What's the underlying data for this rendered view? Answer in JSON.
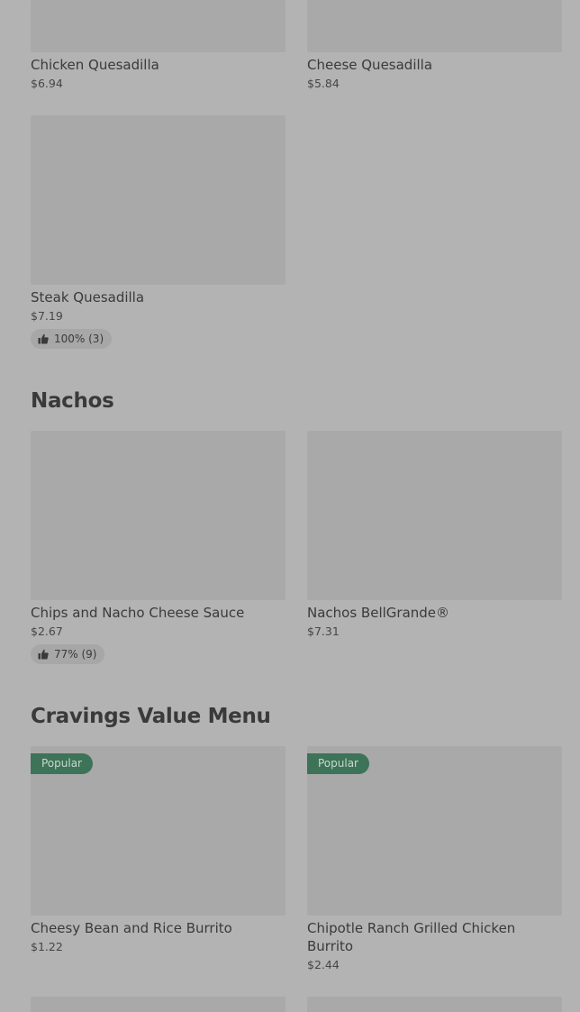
{
  "quesadillas": {
    "items": [
      {
        "name": "Chicken Quesadilla",
        "price": "$6.94"
      },
      {
        "name": "Cheese Quesadilla",
        "price": "$5.84"
      },
      {
        "name": "Steak Quesadilla",
        "price": "$7.19",
        "rating": "100% (3)"
      }
    ]
  },
  "nachos": {
    "title": "Nachos",
    "items": [
      {
        "name": "Chips and Nacho Cheese Sauce",
        "price": "$2.67",
        "rating": "77% (9)"
      },
      {
        "name": "Nachos BellGrande®",
        "price": "$7.31"
      }
    ]
  },
  "cravings": {
    "title": "Cravings Value Menu",
    "items": [
      {
        "name": "Cheesy Bean and Rice Burrito",
        "price": "$1.22",
        "badge": "Popular"
      },
      {
        "name": "Chipotle Ranch Grilled Chicken Burrito",
        "price": "$2.44",
        "badge": "Popular"
      }
    ]
  },
  "colors": {
    "background": "#b3b3b3",
    "image_placeholder": "#a9a9a9",
    "badge": "#3d7358"
  },
  "icons": {
    "rating": "thumbs-up-icon"
  }
}
